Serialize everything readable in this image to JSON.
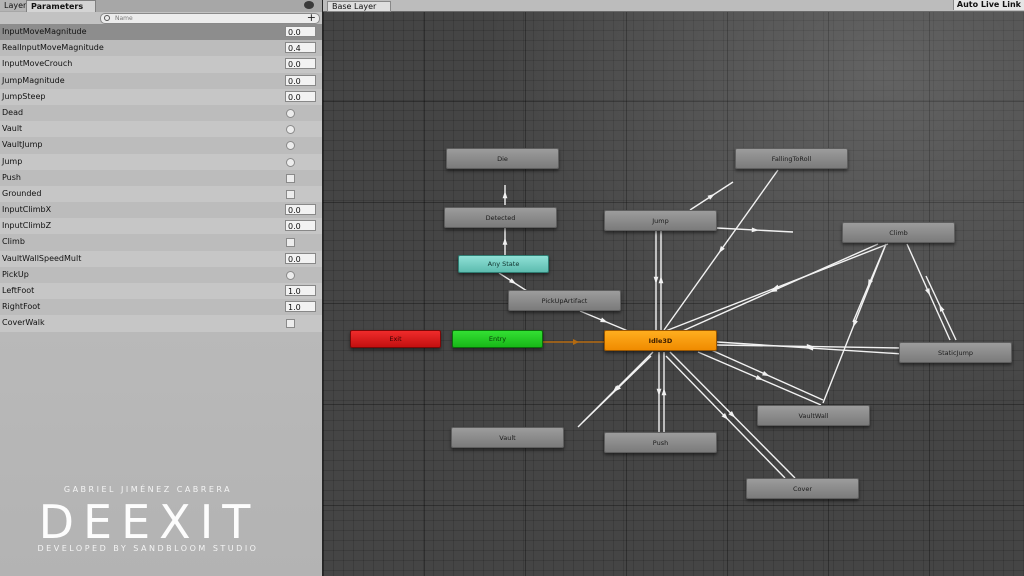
{
  "left_panel": {
    "tabs": {
      "layers": "Layers",
      "parameters": "Parameters"
    },
    "search": {
      "placeholder": "Name"
    },
    "parameters": [
      {
        "name": "InputMoveMagnitude",
        "type": "float",
        "value": "0.0",
        "selected": true
      },
      {
        "name": "RealInputMoveMagnitude",
        "type": "float",
        "value": "0.4"
      },
      {
        "name": "InputMoveCrouch",
        "type": "float",
        "value": "0.0"
      },
      {
        "name": "JumpMagnitude",
        "type": "float",
        "value": "0.0"
      },
      {
        "name": "JumpSteep",
        "type": "float",
        "value": "0.0"
      },
      {
        "name": "Dead",
        "type": "trigger"
      },
      {
        "name": "Vault",
        "type": "trigger"
      },
      {
        "name": "VaultJump",
        "type": "trigger"
      },
      {
        "name": "Jump",
        "type": "trigger"
      },
      {
        "name": "Push",
        "type": "bool",
        "checked": false
      },
      {
        "name": "Grounded",
        "type": "bool",
        "checked": false
      },
      {
        "name": "InputClimbX",
        "type": "float",
        "value": "0.0"
      },
      {
        "name": "InputClimbZ",
        "type": "float",
        "value": "0.0"
      },
      {
        "name": "Climb",
        "type": "bool",
        "checked": false
      },
      {
        "name": "VaultWallSpeedMult",
        "type": "float",
        "value": "0.0"
      },
      {
        "name": "PickUp",
        "type": "trigger"
      },
      {
        "name": "LeftFoot",
        "type": "float",
        "value": "1.0"
      },
      {
        "name": "RightFoot",
        "type": "float",
        "value": "1.0"
      },
      {
        "name": "CoverWalk",
        "type": "bool",
        "checked": false
      }
    ]
  },
  "watermark": {
    "author": "GABRIEL JIMÉNEZ CABRERA",
    "logo": "DEEXIT",
    "developer": "DEVELOPED BY SANDBLOOM STUDIO"
  },
  "graph": {
    "breadcrumb": "Base Layer",
    "live_link": "Auto Live Link",
    "states": {
      "die": "Die",
      "falling_to_roll": "FallingToRoll",
      "detected": "Detected",
      "jump": "Jump",
      "climb": "Climb",
      "any_state": "Any State",
      "pickup_artifact": "PickUpArtifact",
      "exit": "Exit",
      "entry": "Entry",
      "idle3d": "Idle3D",
      "static_jump": "StaticJump",
      "vault_wall": "VaultWall",
      "vault": "Vault",
      "push": "Push",
      "cover": "Cover"
    }
  },
  "colors": {
    "exit": "#d81c1c",
    "entry": "#22c922",
    "any_state": "#74cdc1",
    "default_state": "#8a8a8a",
    "idle_state": "#f59a0c"
  }
}
